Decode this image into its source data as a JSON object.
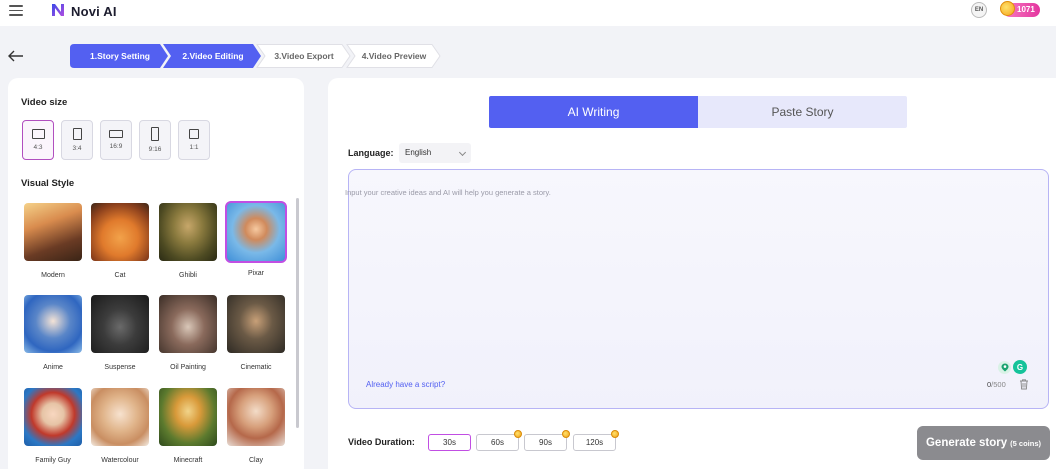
{
  "app": {
    "brand": "Novi AI",
    "coins": "1071",
    "lang_badge": "EN"
  },
  "steps": [
    {
      "label": "1.Story Setting"
    },
    {
      "label": "2.Video Editing"
    },
    {
      "label": "3.Video Export"
    },
    {
      "label": "4.Video Preview"
    }
  ],
  "left": {
    "video_size_title": "Video size",
    "sizes": [
      {
        "label": "4:3",
        "selected": true
      },
      {
        "label": "3:4"
      },
      {
        "label": "16:9"
      },
      {
        "label": "9:16"
      },
      {
        "label": "1:1"
      }
    ],
    "visual_style_title": "Visual Style",
    "styles": [
      {
        "label": "Modern"
      },
      {
        "label": "Cat"
      },
      {
        "label": "Ghibli"
      },
      {
        "label": "Pixar",
        "selected": true
      },
      {
        "label": "Anime"
      },
      {
        "label": "Suspense"
      },
      {
        "label": "Oil Painting"
      },
      {
        "label": "Cinematic"
      },
      {
        "label": "Family Guy"
      },
      {
        "label": "Watercolour"
      },
      {
        "label": "Minecraft"
      },
      {
        "label": "Clay"
      }
    ]
  },
  "right": {
    "tabs": [
      {
        "label": "AI Writing",
        "active": true
      },
      {
        "label": "Paste Story"
      }
    ],
    "language_label": "Language:",
    "language_value": "English",
    "story_placeholder": "Input your creative ideas and AI will help you generate a story.",
    "script_link": "Already have a script?",
    "char_count": "0",
    "char_max": "/500",
    "duration_label": "Video Duration:",
    "durations": [
      {
        "label": "30s",
        "selected": true
      },
      {
        "label": "60s",
        "premium": true
      },
      {
        "label": "90s",
        "premium": true
      },
      {
        "label": "120s",
        "premium": true
      }
    ],
    "generate_label": "Generate story",
    "generate_cost": "(5 coins)"
  },
  "colors": {
    "accent": "#5360f1",
    "selected_border": "#c14ee3",
    "coin_badge": "#e4359f"
  }
}
